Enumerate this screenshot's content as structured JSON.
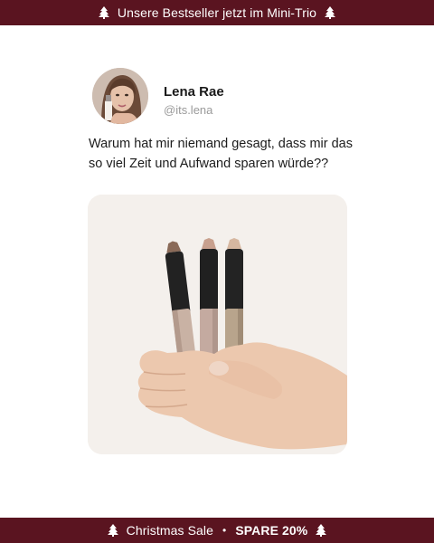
{
  "top_banner": {
    "text": "Unsere Bestseller jetzt im Mini-Trio",
    "icon": "tree-icon"
  },
  "post": {
    "author_name": "Lena Rae",
    "author_handle": "@its.lena",
    "text_line1": "Warum hat mir niemand gesagt, dass mir das",
    "text_line2": "so viel Zeit und Aufwand sparen würde??"
  },
  "bottom_banner": {
    "sale_text": "Christmas Sale",
    "separator": "•",
    "discount_text": "SPARE 20%",
    "icon": "tree-icon"
  },
  "colors": {
    "banner_bg": "#5a1420",
    "banner_text": "#ffffff"
  }
}
